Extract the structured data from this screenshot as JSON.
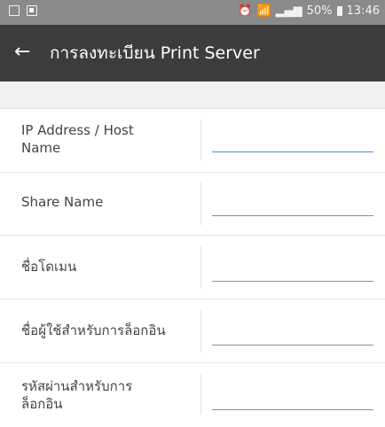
{
  "status_bar": {
    "alarm_icon": "alarm-clock-icon",
    "wifi_icon": "wifi-icon",
    "signal_icon": "signal-icon",
    "battery_percent": "50%",
    "time": "13:46"
  },
  "app_bar": {
    "back_icon": "←",
    "title": "การลงทะเบียน Print Server"
  },
  "form": {
    "fields": [
      {
        "label": "IP Address / Host\nName",
        "value": "",
        "active": true
      },
      {
        "label": "Share Name",
        "value": ""
      },
      {
        "label": "ชื่อโดเมน",
        "value": ""
      },
      {
        "label": "ชื่อผู้ใช้สำหรับการล็อกอิน",
        "value": ""
      },
      {
        "label": "รหัสผ่านสำหรับการ\nล็อกอิน",
        "value": ""
      }
    ]
  },
  "colors": {
    "status_bar": "#8a8a8a",
    "app_bar": "#3c3c3c",
    "accent": "#4a90e2"
  }
}
